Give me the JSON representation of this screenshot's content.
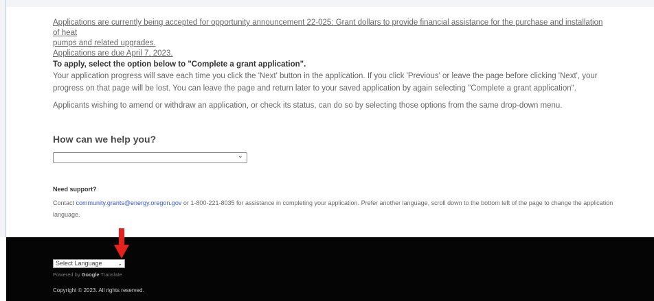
{
  "announcement": {
    "line1": "Applications are currently being accepted for opportunity announcement 22-025: Grant dollars to provide financial assistance for the purchase and installation of heat",
    "line2": "pumps and related upgrades.",
    "line3": "Applications are due April 7, 2023."
  },
  "apply": {
    "title": "To apply, select the option below to \"Complete a grant application\".",
    "paragraph1": "Your application progress will save each time you click the 'Next' button in the application. If you click 'Previous' or leave the page before clicking 'Next', your progress on that page will be lost. You can leave the page and return later to your saved application by again selecting \"Complete a grant application\".",
    "paragraph2": "Applicants wishing to amend or withdraw an application, or check its status, can do so by selecting those options from the same drop-down menu."
  },
  "help": {
    "title": "How can we help you?",
    "selected_value": ""
  },
  "support": {
    "title": "Need support?",
    "text_before": "Contact ",
    "email": "community.grants@energy.oregon.gov",
    "text_after": " or 1-800-221-8035 for assistance in completing your application. Prefer another language, scroll down to the bottom left of the page to change the application language."
  },
  "footer": {
    "language_select": "Select Language",
    "powered_by": "Powered by",
    "google": "Google",
    "translate": "Translate",
    "copyright": "Copyright © 2023. All rights reserved."
  },
  "colors": {
    "footer_bg": "#050505",
    "link": "#3355cc",
    "arrow": "#e8201b"
  }
}
